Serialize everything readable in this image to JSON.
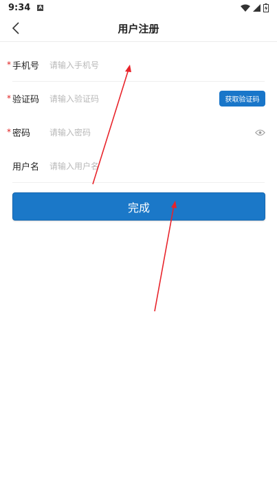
{
  "status_bar": {
    "time": "9:34",
    "notification_badge": "A"
  },
  "header": {
    "title": "用户注册"
  },
  "form": {
    "phone": {
      "label": "手机号",
      "required": "*",
      "placeholder": "请输入手机号",
      "value": ""
    },
    "code": {
      "label": "验证码",
      "required": "*",
      "placeholder": "请输入验证码",
      "value": "",
      "button_label": "获取验证码"
    },
    "password": {
      "label": "密码",
      "required": "*",
      "placeholder": "请输入密码",
      "value": ""
    },
    "username": {
      "label": "用户名",
      "placeholder": "请输入用户名",
      "value": ""
    }
  },
  "submit": {
    "label": "完成"
  },
  "colors": {
    "accent": "#1b78c8",
    "required": "#e02020",
    "annotation_arrow": "#e8232a"
  },
  "icons": {
    "back": "chevron-left-icon",
    "visibility": "eye-icon",
    "wifi": "wifi-icon",
    "signal": "signal-icon",
    "battery": "battery-icon"
  }
}
